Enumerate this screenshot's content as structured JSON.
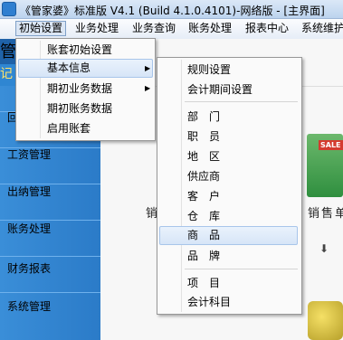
{
  "window": {
    "title": "《管家婆》标准版 V4.1 (Build 4.1.0.4101)-网络版 - [主界面]"
  },
  "menubar": {
    "items": [
      "初始设置",
      "业务处理",
      "业务查询",
      "账务处理",
      "报表中心",
      "系统维护"
    ]
  },
  "sidebar": {
    "partials": [
      "管",
      "记",
      "回"
    ],
    "items": [
      "工资管理",
      "出纳管理",
      "账务处理",
      "财务报表",
      "系统管理"
    ]
  },
  "content": {
    "left_label": "销",
    "right_label": "销售单",
    "sale_badge": "SALE"
  },
  "init_menu": {
    "items": [
      "账套初始设置",
      "基本信息",
      "期初业务数据",
      "期初账务数据",
      "启用账套"
    ]
  },
  "basic_info_menu": {
    "group1": [
      "规则设置",
      "会计期间设置"
    ],
    "group2": [
      "部　门",
      "职　员",
      "地　区",
      "供应商",
      "客　户",
      "仓　库",
      "商　品",
      "品　牌"
    ],
    "group3": [
      "项　目",
      "会计科目"
    ]
  },
  "colors": {
    "sidebar": "#2b7bc8",
    "menu_highlight": "#d6e5f7"
  }
}
